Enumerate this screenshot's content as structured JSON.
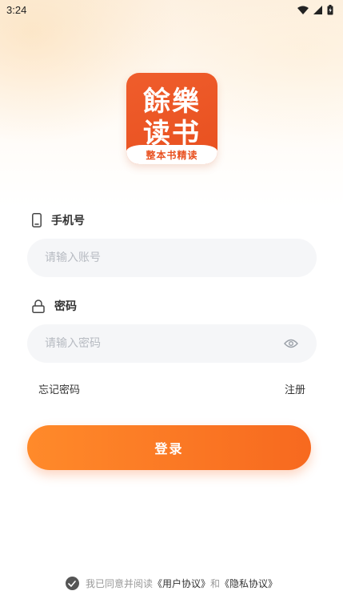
{
  "status_bar": {
    "time": "3:24"
  },
  "logo": {
    "line1": "餘樂",
    "line2": "读书",
    "ribbon": "整本书精读"
  },
  "phone_field": {
    "label": "手机号",
    "placeholder": "请输入账号",
    "value": ""
  },
  "password_field": {
    "label": "密码",
    "placeholder": "请输入密码",
    "value": ""
  },
  "links": {
    "forgot": "忘记密码",
    "register": "注册"
  },
  "login_button": {
    "label": "登录"
  },
  "agreement": {
    "prefix": "我已同意并阅读",
    "user_agreement": "《用户协议》",
    "conjunction": "和",
    "privacy_agreement": "《隐私协议》",
    "checked": true
  },
  "colors": {
    "brand_orange": "#f7691f",
    "logo_red": "#e8501f",
    "input_bg": "#f5f6f8"
  }
}
